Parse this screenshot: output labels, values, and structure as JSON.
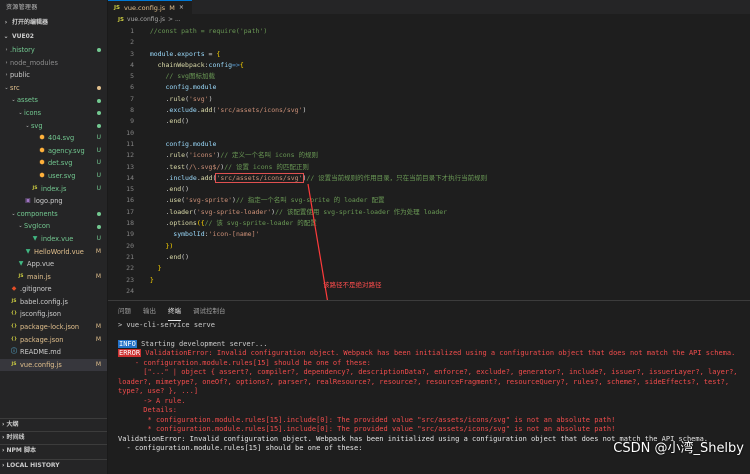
{
  "sidebar": {
    "header": "资源管理器",
    "open_editors": "打开的编辑器",
    "project": "VUE02",
    "tree": [
      {
        "label": ".history",
        "indent": 1,
        "kind": "folder",
        "open": false,
        "color": "green",
        "status": "dot"
      },
      {
        "label": "node_modules",
        "indent": 1,
        "kind": "folder",
        "open": false,
        "color": "gray",
        "status": ""
      },
      {
        "label": "public",
        "indent": 1,
        "kind": "folder",
        "open": false,
        "color": "white",
        "status": ""
      },
      {
        "label": "src",
        "indent": 1,
        "kind": "folder",
        "open": true,
        "color": "orange",
        "status": "dot"
      },
      {
        "label": "assets",
        "indent": 2,
        "kind": "folder",
        "open": true,
        "color": "green",
        "status": "dot"
      },
      {
        "label": "icons",
        "indent": 3,
        "kind": "folder",
        "open": true,
        "color": "green",
        "status": "dot"
      },
      {
        "label": "svg",
        "indent": 4,
        "kind": "folder",
        "open": true,
        "color": "green",
        "status": "dot"
      },
      {
        "label": "404.svg",
        "indent": 5,
        "kind": "svg",
        "color": "green",
        "status": "U"
      },
      {
        "label": "agency.svg",
        "indent": 5,
        "kind": "svg",
        "color": "green",
        "status": "U"
      },
      {
        "label": "det.svg",
        "indent": 5,
        "kind": "svg",
        "color": "green",
        "status": "U"
      },
      {
        "label": "user.svg",
        "indent": 5,
        "kind": "svg",
        "color": "green",
        "status": "U"
      },
      {
        "label": "index.js",
        "indent": 4,
        "kind": "js",
        "color": "green",
        "status": "U"
      },
      {
        "label": "logo.png",
        "indent": 3,
        "kind": "img",
        "color": "white",
        "status": ""
      },
      {
        "label": "components",
        "indent": 2,
        "kind": "folder",
        "open": true,
        "color": "green",
        "status": "dot"
      },
      {
        "label": "SvgIcon",
        "indent": 3,
        "kind": "folder",
        "open": true,
        "color": "green",
        "status": "dot"
      },
      {
        "label": "index.vue",
        "indent": 4,
        "kind": "vue",
        "color": "green",
        "status": "U"
      },
      {
        "label": "HelloWorld.vue",
        "indent": 3,
        "kind": "vue",
        "color": "orange",
        "status": "M"
      },
      {
        "label": "App.vue",
        "indent": 2,
        "kind": "vue",
        "color": "white",
        "status": ""
      },
      {
        "label": "main.js",
        "indent": 2,
        "kind": "js",
        "color": "orange",
        "status": "M"
      },
      {
        "label": ".gitignore",
        "indent": 1,
        "kind": "git",
        "color": "white",
        "status": ""
      },
      {
        "label": "babel.config.js",
        "indent": 1,
        "kind": "js",
        "color": "white",
        "status": ""
      },
      {
        "label": "jsconfig.json",
        "indent": 1,
        "kind": "json",
        "color": "white",
        "status": ""
      },
      {
        "label": "package-lock.json",
        "indent": 1,
        "kind": "json",
        "color": "orange",
        "status": "M"
      },
      {
        "label": "package.json",
        "indent": 1,
        "kind": "json",
        "color": "orange",
        "status": "M"
      },
      {
        "label": "README.md",
        "indent": 1,
        "kind": "md",
        "color": "white",
        "status": ""
      },
      {
        "label": "vue.config.js",
        "indent": 1,
        "kind": "js",
        "color": "orange",
        "status": "M",
        "active": true
      }
    ],
    "bottom_sections": [
      "大纲",
      "时间线",
      "NPM 脚本",
      "LOCAL HISTORY"
    ]
  },
  "editor": {
    "tab_label": "vue.config.js",
    "tab_status": "M",
    "tab_js": "JS",
    "breadcrumb_file": "vue.config.js",
    "breadcrumb_rest": "> ...",
    "lines": [
      {
        "n": "1",
        "tokens": [
          {
            "t": "  //const path = require('path')",
            "c": "comment"
          }
        ]
      },
      {
        "n": "2",
        "tokens": []
      },
      {
        "n": "3",
        "tokens": [
          {
            "t": "  module",
            "c": "prop"
          },
          {
            "t": ".",
            "c": "plain"
          },
          {
            "t": "exports",
            "c": "prop"
          },
          {
            "t": " = ",
            "c": "plain"
          },
          {
            "t": "{",
            "c": "brace"
          }
        ]
      },
      {
        "n": "4",
        "tokens": [
          {
            "t": "    chainWebpack",
            "c": "fn"
          },
          {
            "t": ":",
            "c": "plain"
          },
          {
            "t": "config",
            "c": "prop"
          },
          {
            "t": "=>",
            "c": "kw"
          },
          {
            "t": "{",
            "c": "brace"
          }
        ]
      },
      {
        "n": "5",
        "tokens": [
          {
            "t": "      // svg图标加载",
            "c": "comment"
          }
        ]
      },
      {
        "n": "6",
        "tokens": [
          {
            "t": "      config",
            "c": "prop"
          },
          {
            "t": ".",
            "c": "plain"
          },
          {
            "t": "module",
            "c": "prop"
          }
        ]
      },
      {
        "n": "7",
        "tokens": [
          {
            "t": "      .",
            "c": "plain"
          },
          {
            "t": "rule",
            "c": "fn"
          },
          {
            "t": "(",
            "c": "plain"
          },
          {
            "t": "'svg'",
            "c": "string"
          },
          {
            "t": ")",
            "c": "plain"
          }
        ]
      },
      {
        "n": "8",
        "tokens": [
          {
            "t": "      .",
            "c": "plain"
          },
          {
            "t": "exclude",
            "c": "prop"
          },
          {
            "t": ".",
            "c": "plain"
          },
          {
            "t": "add",
            "c": "fn"
          },
          {
            "t": "(",
            "c": "plain"
          },
          {
            "t": "'src/assets/icons/svg'",
            "c": "string"
          },
          {
            "t": ")",
            "c": "plain"
          }
        ]
      },
      {
        "n": "9",
        "tokens": [
          {
            "t": "      .",
            "c": "plain"
          },
          {
            "t": "end",
            "c": "fn"
          },
          {
            "t": "()",
            "c": "plain"
          }
        ]
      },
      {
        "n": "10",
        "tokens": []
      },
      {
        "n": "11",
        "tokens": [
          {
            "t": "      config",
            "c": "prop"
          },
          {
            "t": ".",
            "c": "plain"
          },
          {
            "t": "module",
            "c": "prop"
          }
        ]
      },
      {
        "n": "12",
        "tokens": [
          {
            "t": "      .",
            "c": "plain"
          },
          {
            "t": "rule",
            "c": "fn"
          },
          {
            "t": "(",
            "c": "plain"
          },
          {
            "t": "'icons'",
            "c": "string"
          },
          {
            "t": ")",
            "c": "plain"
          },
          {
            "t": "// 定义一个名叫 icons 的规则",
            "c": "comment"
          }
        ]
      },
      {
        "n": "13",
        "tokens": [
          {
            "t": "      .",
            "c": "plain"
          },
          {
            "t": "test",
            "c": "fn"
          },
          {
            "t": "(",
            "c": "plain"
          },
          {
            "t": "/\\.svg$/",
            "c": "string"
          },
          {
            "t": ")",
            "c": "plain"
          },
          {
            "t": "// 设置 icons 的匹配正则",
            "c": "comment"
          }
        ]
      },
      {
        "n": "14",
        "tokens": [
          {
            "t": "      .",
            "c": "plain"
          },
          {
            "t": "include",
            "c": "prop"
          },
          {
            "t": ".",
            "c": "plain"
          },
          {
            "t": "add",
            "c": "fn"
          },
          {
            "t": "(",
            "c": "plain"
          },
          {
            "t": "'src/assets/icons/svg'",
            "c": "string",
            "box": true
          },
          {
            "t": ")",
            "c": "plain"
          },
          {
            "t": "// 设置当前规则的作用目录，只在当前目录下才执行当前规则",
            "c": "comment"
          }
        ]
      },
      {
        "n": "15",
        "tokens": [
          {
            "t": "      .",
            "c": "plain"
          },
          {
            "t": "end",
            "c": "fn"
          },
          {
            "t": "()",
            "c": "plain"
          }
        ]
      },
      {
        "n": "16",
        "tokens": [
          {
            "t": "      .",
            "c": "plain"
          },
          {
            "t": "use",
            "c": "fn"
          },
          {
            "t": "(",
            "c": "plain"
          },
          {
            "t": "'svg-sprite'",
            "c": "string"
          },
          {
            "t": ")",
            "c": "plain"
          },
          {
            "t": "// 指定一个名叫 svg-sprite 的 loader 配置",
            "c": "comment"
          }
        ]
      },
      {
        "n": "17",
        "tokens": [
          {
            "t": "      .",
            "c": "plain"
          },
          {
            "t": "loader",
            "c": "fn"
          },
          {
            "t": "(",
            "c": "plain"
          },
          {
            "t": "'svg-sprite-loader'",
            "c": "string"
          },
          {
            "t": ")",
            "c": "plain"
          },
          {
            "t": "// 该配置使用 svg-sprite-loader 作为处理 loader",
            "c": "comment"
          }
        ]
      },
      {
        "n": "18",
        "tokens": [
          {
            "t": "      .",
            "c": "plain"
          },
          {
            "t": "options",
            "c": "fn"
          },
          {
            "t": "({",
            "c": "brace"
          },
          {
            "t": "// 该 svg-sprite-loader 的配置",
            "c": "comment"
          }
        ]
      },
      {
        "n": "19",
        "tokens": [
          {
            "t": "        symbolId",
            "c": "prop"
          },
          {
            "t": ":",
            "c": "plain"
          },
          {
            "t": "'icon-[name]'",
            "c": "string"
          }
        ]
      },
      {
        "n": "20",
        "tokens": [
          {
            "t": "      })",
            "c": "brace"
          }
        ]
      },
      {
        "n": "21",
        "tokens": [
          {
            "t": "      .",
            "c": "plain"
          },
          {
            "t": "end",
            "c": "fn"
          },
          {
            "t": "()",
            "c": "plain"
          }
        ]
      },
      {
        "n": "22",
        "tokens": [
          {
            "t": "    }",
            "c": "brace"
          }
        ]
      },
      {
        "n": "23",
        "tokens": [
          {
            "t": "  }",
            "c": "brace"
          }
        ]
      },
      {
        "n": "24",
        "tokens": []
      }
    ],
    "annotation": "该路径不是绝对路径"
  },
  "panel": {
    "tabs": [
      {
        "label": "问题",
        "active": false
      },
      {
        "label": "输出",
        "active": false
      },
      {
        "label": "终端",
        "active": true
      },
      {
        "label": "调试控制台",
        "active": false
      }
    ],
    "prompt": "> vue-cli-service serve",
    "info_label": "INFO",
    "info_text": " Starting development server...",
    "error_label": "ERROR",
    "error_text": " ValidationError: Invalid configuration object. Webpack has been initialized using a configuration object that does not match the API schema.",
    "lines": [
      {
        "t": "    - configuration.module.rules[15] should be one of these:",
        "c": "red"
      },
      {
        "t": "      [\"...\" | object { assert?, compiler?, dependency?, descriptionData?, enforce?, exclude?, generator?, include?, issuer?, issuerLayer?, layer?, loader?, mimetype?, oneOf?, options?, parser?, realResource?, resource?, resourceFragment?, resourceQuery?, rules?, scheme?, sideEffects?, test?, type?, use? }, ...]",
        "c": "red"
      },
      {
        "t": "      -> A rule.",
        "c": "red"
      },
      {
        "t": "      Details:",
        "c": "red"
      },
      {
        "t": "       * configuration.module.rules[15].include[0]: The provided value \"src/assets/icons/svg\" is not an absolute path!",
        "c": "red"
      },
      {
        "t": "       * configuration.module.rules[15].include[0]: The provided value \"src/assets/icons/svg\" is not an absolute path!",
        "c": "red"
      },
      {
        "t": "ValidationError: Invalid configuration object. Webpack has been initialized using a configuration object that does not match the API schema.",
        "c": "white"
      },
      {
        "t": "  - configuration.module.rules[15] should be one of these:",
        "c": "white"
      }
    ],
    "watermark": "CSDN @小湾_Shelby"
  },
  "colors": {
    "accent": "#0078d4",
    "modified": "#e2c08d",
    "untracked": "#73c991",
    "error": "#f14c4c",
    "annotation": "#ff4d4d"
  }
}
